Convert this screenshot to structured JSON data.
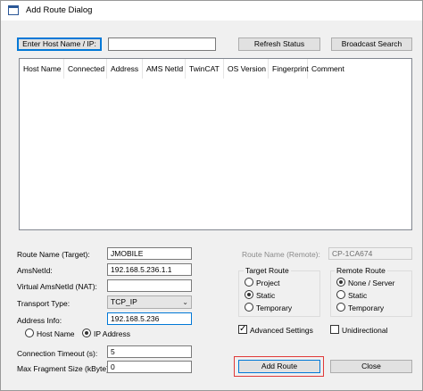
{
  "window": {
    "title": "Add Route Dialog",
    "icon": "twincat-app-icon"
  },
  "top": {
    "enter_host_label": "Enter Host Name / IP:",
    "host_input_value": "",
    "refresh_label": "Refresh Status",
    "broadcast_label": "Broadcast Search"
  },
  "list": {
    "columns": [
      "Host Name",
      "Connected",
      "Address",
      "AMS NetId",
      "TwinCAT",
      "OS Version",
      "Fingerprint",
      "Comment"
    ],
    "rows": []
  },
  "form": {
    "route_name_label": "Route Name (Target):",
    "route_name_value": "JMOBILE",
    "amsnetid_label": "AmsNetId:",
    "amsnetid_value": "192.168.5.236.1.1",
    "virtual_amsnetid_label": "Virtual AmsNetId (NAT):",
    "virtual_amsnetid_value": "",
    "transport_label": "Transport Type:",
    "transport_value": "TCP_IP",
    "address_info_label": "Address Info:",
    "address_info_value": "192.168.5.236",
    "host_name_radio": "Host Name",
    "ip_address_radio": "IP Address",
    "address_mode": "ip",
    "conn_timeout_label": "Connection Timeout (s):",
    "conn_timeout_value": "5",
    "max_frag_label": "Max Fragment Size (kByte):",
    "max_frag_value": "0"
  },
  "remote": {
    "route_name_remote_label": "Route Name (Remote):",
    "route_name_remote_value": "CP-1CA674"
  },
  "target_route": {
    "title": "Target Route",
    "options": [
      "Project",
      "Static",
      "Temporary"
    ],
    "selected": 1
  },
  "remote_route": {
    "title": "Remote Route",
    "options": [
      "None / Server",
      "Static",
      "Temporary"
    ],
    "selected": 0
  },
  "advanced_settings": {
    "label": "Advanced Settings",
    "checked": true
  },
  "unidirectional": {
    "label": "Unidirectional",
    "checked": false
  },
  "actions": {
    "add_route_label": "Add Route",
    "close_label": "Close"
  },
  "colors": {
    "focus_blue": "#0078d7",
    "highlight_red": "#e03a3a"
  }
}
